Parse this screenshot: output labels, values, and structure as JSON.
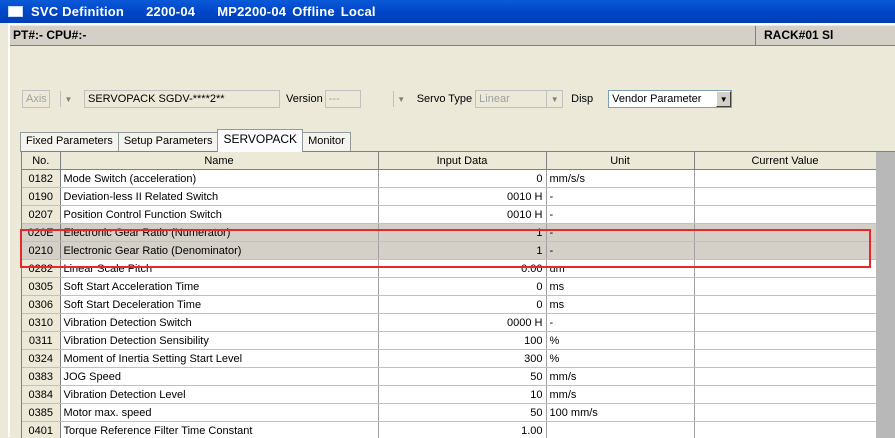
{
  "window": {
    "title_parts": [
      "SVC Definition",
      "2200-04",
      "MP2200-04",
      "Offline",
      "Local"
    ],
    "titlebar_color": "#0046c8"
  },
  "infobar": {
    "pt_cpu": "PT#:- CPU#:-",
    "rack": "RACK#01 Sl"
  },
  "filters": {
    "axis": "Axis 1",
    "servopack": "SERVOPACK SGDV-****2**",
    "version_label": "Version",
    "version_value": "---",
    "servo_type_label": "Servo Type",
    "servo_type_value": "Linear",
    "disp_label": "Disp",
    "disp_value": "Vendor Parameter"
  },
  "tabs": [
    "Fixed Parameters",
    "Setup Parameters",
    "SERVOPACK",
    "Monitor"
  ],
  "active_tab": 2,
  "table": {
    "columns": [
      "No.",
      "Name",
      "Input Data",
      "Unit",
      "Current Value"
    ],
    "rows": [
      {
        "no": "0182",
        "name": "Mode Switch (acceleration)",
        "input": "0",
        "unit": "mm/s/s",
        "current": ""
      },
      {
        "no": "0190",
        "name": "Deviation-less II Related Switch",
        "input": "0010 H",
        "unit": "-",
        "current": ""
      },
      {
        "no": "0207",
        "name": "Position Control Function Switch",
        "input": "0010 H",
        "unit": "-",
        "current": ""
      },
      {
        "no": "020E",
        "name": "Electronic Gear Ratio (Numerator)",
        "input": "1",
        "unit": "-",
        "current": "",
        "highlight": true
      },
      {
        "no": "0210",
        "name": "Electronic Gear Ratio (Denominator)",
        "input": "1",
        "unit": "-",
        "current": "",
        "highlight": true
      },
      {
        "no": "0282",
        "name": "Linear Scale Pitch",
        "input": "0.00",
        "unit": "um",
        "current": ""
      },
      {
        "no": "0305",
        "name": "Soft Start Acceleration Time",
        "input": "0",
        "unit": "ms",
        "current": ""
      },
      {
        "no": "0306",
        "name": "Soft Start Deceleration Time",
        "input": "0",
        "unit": "ms",
        "current": ""
      },
      {
        "no": "0310",
        "name": "Vibration Detection Switch",
        "input": "0000 H",
        "unit": "-",
        "current": ""
      },
      {
        "no": "0311",
        "name": "Vibration Detection Sensibility",
        "input": "100",
        "unit": "%",
        "current": ""
      },
      {
        "no": "0324",
        "name": "Moment of Inertia Setting Start Level",
        "input": "300",
        "unit": "%",
        "current": ""
      },
      {
        "no": "0383",
        "name": "JOG Speed",
        "input": "50",
        "unit": "mm/s",
        "current": ""
      },
      {
        "no": "0384",
        "name": "Vibration Detection Level",
        "input": "10",
        "unit": "mm/s",
        "current": ""
      },
      {
        "no": "0385",
        "name": "Motor max. speed",
        "input": "50",
        "unit": "100 mm/s",
        "current": ""
      },
      {
        "no": "0401",
        "name": "Torque Reference Filter Time Constant",
        "input": "1.00",
        "unit": "",
        "current": ""
      }
    ]
  },
  "highlight_color": "#e8292a"
}
